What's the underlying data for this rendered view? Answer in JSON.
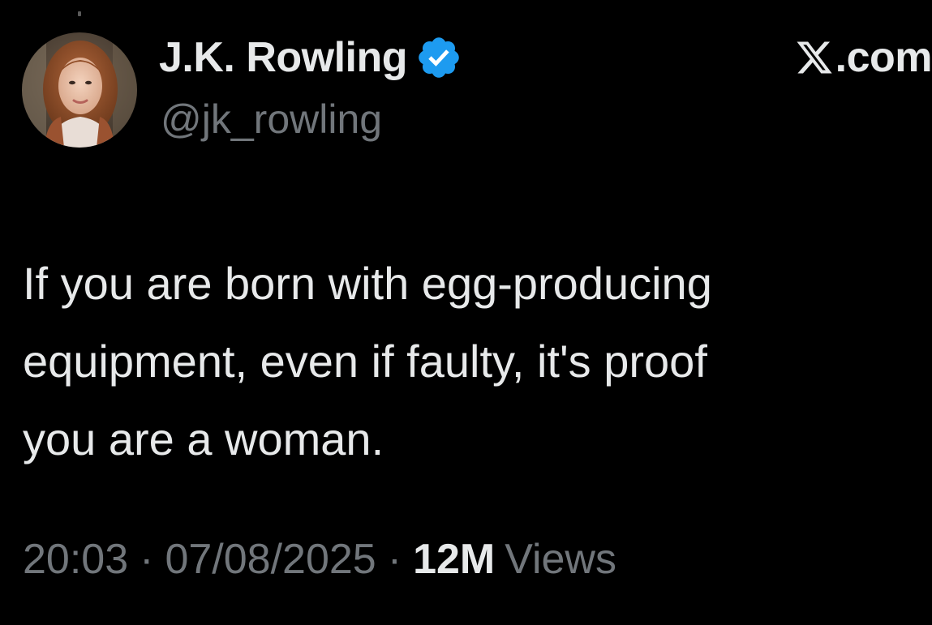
{
  "author": {
    "display_name": "J.K. Rowling",
    "handle": "@jk_rowling",
    "verified": true,
    "avatar_icon": "profile-photo"
  },
  "brand": {
    "logo_icon": "x-logo-icon",
    "text": ".com"
  },
  "tweet": {
    "text": "If you are born with egg-producing\nequipment, even if faulty, it's proof\nyou are a woman."
  },
  "meta": {
    "time": "20:03",
    "separator": "·",
    "date": "07/08/2025",
    "views_count": "12M",
    "views_label": "Views"
  },
  "colors": {
    "background": "#000000",
    "primary_text": "#e7e9ea",
    "secondary_text": "#71767b",
    "verified_badge": "#1d9bf0"
  }
}
